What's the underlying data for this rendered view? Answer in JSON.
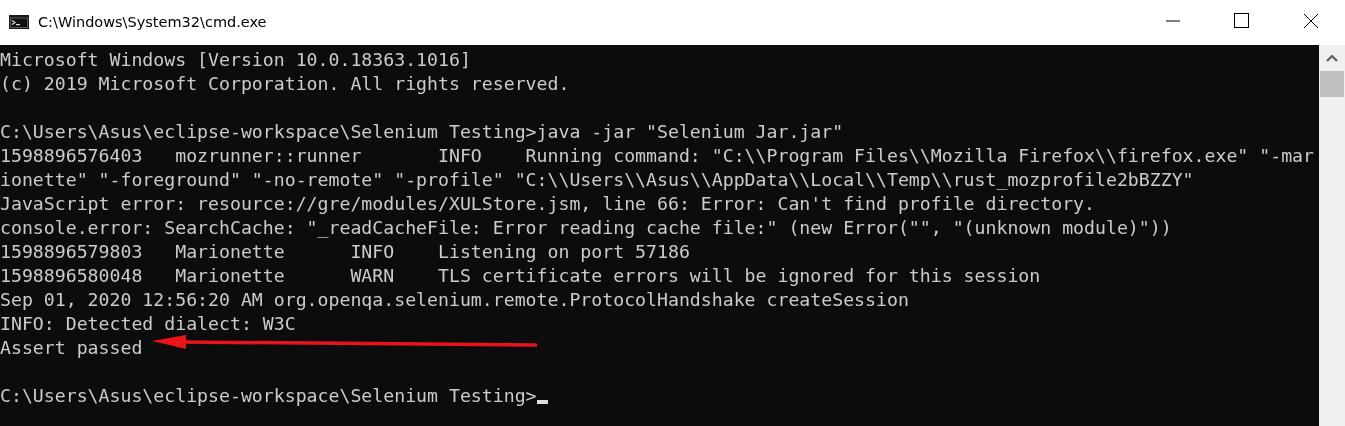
{
  "window": {
    "title": "C:\\Windows\\System32\\cmd.exe"
  },
  "console": {
    "blocks": [
      [
        "Microsoft Windows [Version 10.0.18363.1016]",
        "(c) 2019 Microsoft Corporation. All rights reserved."
      ],
      [
        "C:\\Users\\Asus\\eclipse-workspace\\Selenium Testing>java -jar \"Selenium Jar.jar\"",
        "1598896576403   mozrunner::runner       INFO    Running command: \"C:\\\\Program Files\\\\Mozilla Firefox\\\\firefox.exe\" \"-mar",
        "ionette\" \"-foreground\" \"-no-remote\" \"-profile\" \"C:\\\\Users\\\\Asus\\\\AppData\\\\Local\\\\Temp\\\\rust_mozprofile2bBZZY\"",
        "JavaScript error: resource://gre/modules/XULStore.jsm, line 66: Error: Can't find profile directory.",
        "console.error: SearchCache: \"_readCacheFile: Error reading cache file:\" (new Error(\"\", \"(unknown module)\"))",
        "1598896579803   Marionette      INFO    Listening on port 57186",
        "1598896580048   Marionette      WARN    TLS certificate errors will be ignored for this session",
        "Sep 01, 2020 12:56:20 AM org.openqa.selenium.remote.ProtocolHandshake createSession",
        "INFO: Detected dialect: W3C",
        "Assert passed"
      ],
      [
        "C:\\Users\\Asus\\eclipse-workspace\\Selenium Testing>"
      ]
    ]
  }
}
